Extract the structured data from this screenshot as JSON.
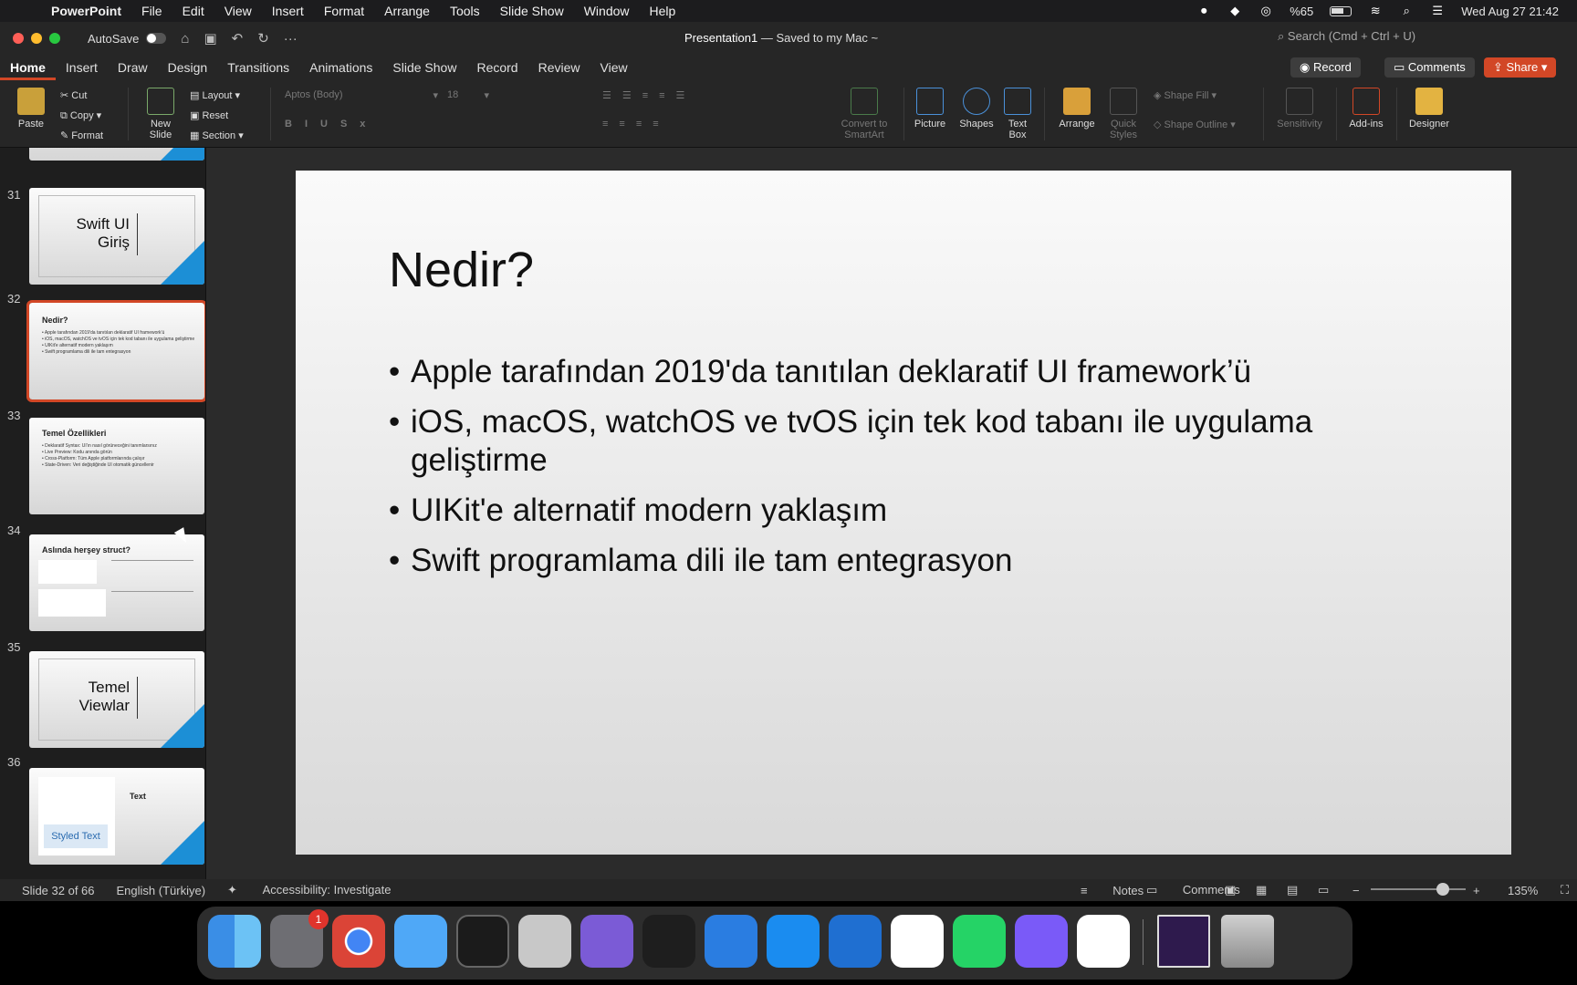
{
  "menubar": {
    "app": "PowerPoint",
    "items": [
      "File",
      "Edit",
      "View",
      "Insert",
      "Format",
      "Arrange",
      "Tools",
      "Slide Show",
      "Window",
      "Help"
    ],
    "battery": "%65",
    "datetime": "Wed Aug 27  21:42"
  },
  "titlebar": {
    "autosave": "AutoSave",
    "doc_name": "Presentation1",
    "doc_status": " — Saved to my Mac ~",
    "search_placeholder": "Search (Cmd + Ctrl + U)"
  },
  "tabs": [
    "Home",
    "Insert",
    "Draw",
    "Design",
    "Transitions",
    "Animations",
    "Slide Show",
    "Record",
    "Review",
    "View"
  ],
  "tab_buttons": {
    "record": "Record",
    "comments": "Comments",
    "share": "Share"
  },
  "ribbon": {
    "paste": "Paste",
    "cut": "Cut",
    "copy": "Copy",
    "format": "Format",
    "new_slide": "New Slide",
    "layout": "Layout",
    "reset": "Reset",
    "section": "Section",
    "font_name": "Aptos (Body)",
    "font_size": "18",
    "convert_smartart": "Convert to SmartArt",
    "picture": "Picture",
    "shapes": "Shapes",
    "text_box": "Text Box",
    "arrange": "Arrange",
    "quick_styles": "Quick Styles",
    "shape_fill": "Shape Fill",
    "shape_outline": "Shape Outline",
    "sensitivity": "Sensitivity",
    "addins": "Add-ins",
    "designer": "Designer"
  },
  "thumbnails": [
    {
      "num": "31",
      "big": "Swift UI\nGiriş"
    },
    {
      "num": "32",
      "title": "Nedir?",
      "lines": "• Apple tarafından 2019'da tanıtılan deklaratif UI framework'ü\n• iOS, macOS, watchOS ve tvOS için tek kod tabanı ile uygulama geliştirme\n• UIKit'e alternatif modern yaklaşım\n• Swift programlama dili ile tam entegrasyon"
    },
    {
      "num": "33",
      "title": "Temel Özellikleri",
      "lines": "• Deklaratif Syntax: UI'ın nasıl görüneceğini tanımlarsınız\n• Live Preview: Kodu anında görün\n• Cross-Platform: Tüm Apple platformlarında çalışır\n• State-Driven: Veri değiştiğinde UI otomatik güncellenir"
    },
    {
      "num": "34",
      "title": "Aslında herşey struct?"
    },
    {
      "num": "35",
      "big": "Temel\nViewlar"
    },
    {
      "num": "36",
      "title": "Text",
      "button": "Styled Text"
    }
  ],
  "slide": {
    "title": "Nedir?",
    "bullets": [
      "Apple tarafından 2019'da tanıtılan deklaratif UI framework’ü",
      "iOS, macOS, watchOS ve tvOS için tek kod tabanı ile uygulama geliştirme",
      "UIKit'e alternatif modern yaklaşım",
      "Swift programlama dili ile tam entegrasyon"
    ]
  },
  "status": {
    "slide_count": "Slide 32 of 66",
    "language": "English (Türkiye)",
    "accessibility": "Accessibility: Investigate",
    "notes": "Notes",
    "comments": "Comments",
    "zoom": "135%"
  },
  "dock": {
    "settings_badge": "1"
  }
}
